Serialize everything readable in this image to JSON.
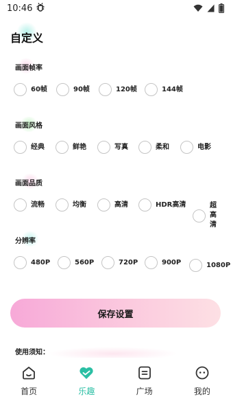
{
  "status_bar": {
    "time": "10:46",
    "app_icon": "bug-icon",
    "signal": "wifi-icon",
    "cell": "cell-signal-icon",
    "battery": "battery-icon"
  },
  "page": {
    "title": "自定义"
  },
  "sections": {
    "frame_rate": {
      "label": "画面帧率",
      "options": [
        "60帧",
        "90帧",
        "120帧",
        "144帧"
      ]
    },
    "style": {
      "label": "画面风格",
      "options": [
        "经典",
        "鲜艳",
        "写真",
        "柔和",
        "电影"
      ]
    },
    "quality": {
      "label": "画面品质",
      "options": [
        "流畅",
        "均衡",
        "高清",
        "HDR高清",
        "超高清"
      ]
    },
    "resolution": {
      "label": "分辨率",
      "options": [
        "480P",
        "560P",
        "720P",
        "900P",
        "1080P"
      ]
    }
  },
  "actions": {
    "save_label": "保存设置"
  },
  "notice": {
    "label": "使用须知："
  },
  "tab_bar": {
    "active": "乐趣",
    "tabs": [
      {
        "label": "首页",
        "icon": "home-icon"
      },
      {
        "label": "乐趣",
        "icon": "heart-icon"
      },
      {
        "label": "广场",
        "icon": "square-list-icon"
      },
      {
        "label": "我的",
        "icon": "profile-face-icon"
      }
    ]
  },
  "colors": {
    "accent": "#2bbfa4",
    "button_gradient_start": "#f7a9d8",
    "button_gradient_end": "#fde0e4",
    "radio_border": "#c4c4c4"
  }
}
